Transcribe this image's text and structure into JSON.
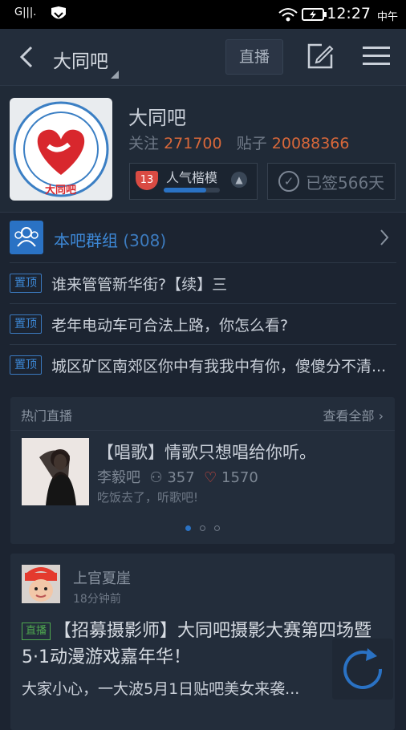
{
  "status_bar": {
    "signal": "G|||.",
    "time": "12:27",
    "ampm": "中午"
  },
  "nav": {
    "title": "大同吧",
    "live_label": "直播"
  },
  "forum": {
    "name": "大同吧",
    "follow_label": "关注",
    "follow_count": "271700",
    "posts_label": "贴子",
    "posts_count": "20088366",
    "level": "13",
    "level_title": "人气楷模",
    "level_progress": 0.75,
    "signed_label": "已签566天",
    "logo_text": "大同吧"
  },
  "group": {
    "label": "本吧群组",
    "count": "(308)"
  },
  "pinned": [
    {
      "tag": "置顶",
      "title": "谁来管管新华街?【续】三"
    },
    {
      "tag": "置顶",
      "title": "老年电动车可合法上路，你怎么看?"
    },
    {
      "tag": "置顶",
      "title": "城区矿区南郊区你中有我我中有你，傻傻分不清..."
    }
  ],
  "live": {
    "header": "热门直播",
    "view_all": "查看全部",
    "title": "【唱歌】情歌只想唱给你听。",
    "source": "李毅吧",
    "viewers": "357",
    "likes": "1570",
    "subtitle": "吃饭去了，听歌吧!",
    "pages": 3,
    "active_page": 1
  },
  "post": {
    "author": "上官夏崖",
    "time": "18分钟前",
    "tag": "直播",
    "title": "【招募摄影师】大同吧摄影大赛第四场暨5·1动漫游戏嘉年华！",
    "excerpt": "大家小心，一大波5月1日贴吧美女来袭..."
  },
  "colors": {
    "accent": "#2a72c4",
    "orange": "#d9683a",
    "bg": "#1c2431"
  }
}
